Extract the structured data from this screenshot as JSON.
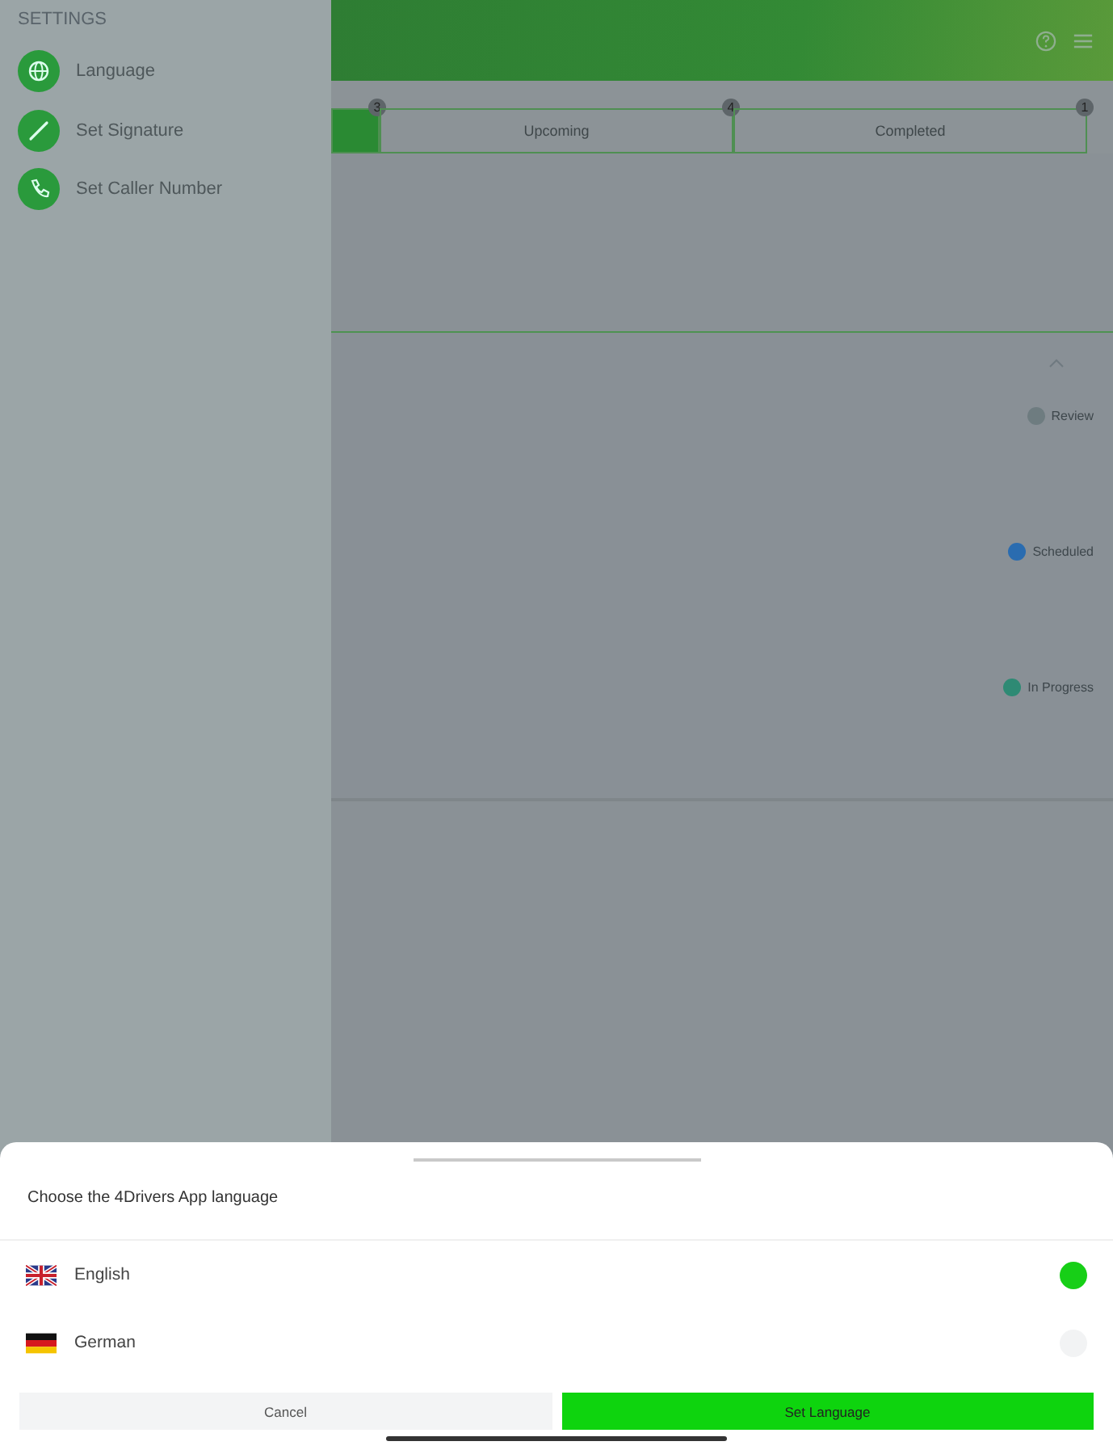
{
  "sidebar": {
    "heading": "SETTINGS",
    "items": [
      {
        "label": "Language"
      },
      {
        "label": "Set Signature"
      },
      {
        "label": "Set Caller Number"
      }
    ]
  },
  "tabs": [
    {
      "badge": "3",
      "selected": true
    },
    {
      "label": "Upcoming",
      "badge": "4",
      "selected": false
    },
    {
      "label": "Completed",
      "badge": "1",
      "selected": false
    }
  ],
  "legend": [
    {
      "label": "Review",
      "color": "#6e7c80"
    },
    {
      "label": "Scheduled",
      "color": "#2a6cb0"
    },
    {
      "label": "In Progress",
      "color": "#2e8a74"
    }
  ],
  "sheet": {
    "title": "Choose the 4Drivers App language",
    "languages": [
      {
        "label": "English",
        "kind": "uk",
        "selected": true
      },
      {
        "label": "German",
        "kind": "de",
        "selected": false
      }
    ],
    "cancel": "Cancel",
    "confirm": "Set Language"
  }
}
